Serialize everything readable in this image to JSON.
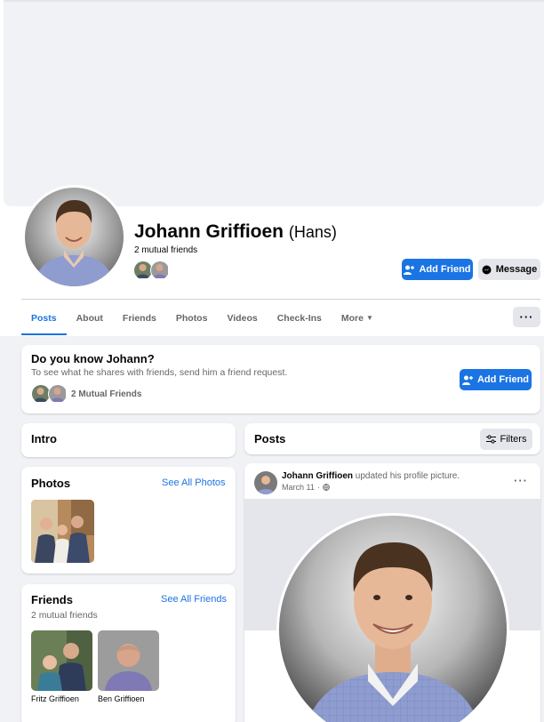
{
  "profile": {
    "name": "Johann Griffioen",
    "nickname": "(Hans)",
    "mutual_friends": "2 mutual friends"
  },
  "actions": {
    "add_friend": "Add Friend",
    "message": "Message"
  },
  "tabs": [
    {
      "label": "Posts",
      "active": true
    },
    {
      "label": "About"
    },
    {
      "label": "Friends"
    },
    {
      "label": "Photos"
    },
    {
      "label": "Videos"
    },
    {
      "label": "Check-Ins"
    },
    {
      "label": "More"
    }
  ],
  "more_menu": "···",
  "know": {
    "title": "Do you know Johann?",
    "subtitle": "To see what he shares with friends, send him a friend request.",
    "mutual": "2 Mutual Friends",
    "add_friend": "Add Friend"
  },
  "intro": {
    "title": "Intro"
  },
  "photos": {
    "title": "Photos",
    "see_all": "See All Photos"
  },
  "friends": {
    "title": "Friends",
    "see_all": "See All Friends",
    "count": "2 mutual friends",
    "items": [
      {
        "name": "Fritz Griffioen"
      },
      {
        "name": "Ben Griffioen"
      }
    ]
  },
  "posts": {
    "title": "Posts",
    "filters": "Filters"
  },
  "post": {
    "author": "Johann Griffioen",
    "action": "updated his profile picture.",
    "date": "March 11",
    "menu": "···"
  },
  "colors": {
    "accent": "#1b74e4",
    "page_bg": "#f0f2f5",
    "secondary_text": "#65676b"
  }
}
